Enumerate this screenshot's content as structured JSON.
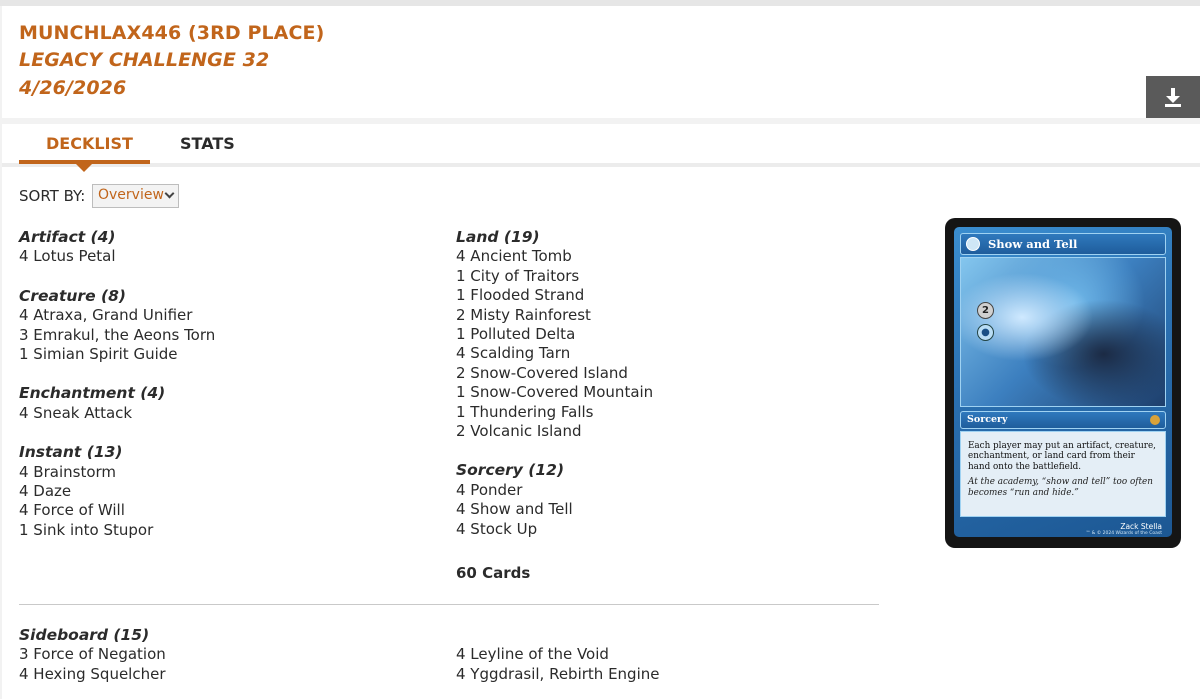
{
  "header": {
    "player": "MUNCHLAX446 (3RD PLACE)",
    "event": "LEGACY CHALLENGE 32",
    "date": "4/26/2026",
    "download_icon": "download-icon"
  },
  "tabs": [
    {
      "label": "DECKLIST",
      "active": true
    },
    {
      "label": "STATS",
      "active": false
    }
  ],
  "sort": {
    "label": "SORT BY:",
    "value": "Overview"
  },
  "main_left": [
    {
      "title": "Artifact (4)",
      "cards": [
        "4 Lotus Petal"
      ]
    },
    {
      "title": "Creature (8)",
      "cards": [
        "4 Atraxa, Grand Unifier",
        "3 Emrakul, the Aeons Torn",
        "1 Simian Spirit Guide"
      ]
    },
    {
      "title": "Enchantment (4)",
      "cards": [
        "4 Sneak Attack"
      ]
    },
    {
      "title": "Instant (13)",
      "cards": [
        "4 Brainstorm",
        "4 Daze",
        "4 Force of Will",
        "1 Sink into Stupor"
      ]
    }
  ],
  "main_right": [
    {
      "title": "Land (19)",
      "cards": [
        "4 Ancient Tomb",
        "1 City of Traitors",
        "1 Flooded Strand",
        "2 Misty Rainforest",
        "1 Polluted Delta",
        "4 Scalding Tarn",
        "2 Snow-Covered Island",
        "1 Snow-Covered Mountain",
        "1 Thundering Falls",
        "2 Volcanic Island"
      ]
    },
    {
      "title": "Sorcery (12)",
      "cards": [
        "4 Ponder",
        "4 Show and Tell",
        "4 Stock Up"
      ]
    }
  ],
  "total": "60 Cards",
  "sideboard": {
    "title": "Sideboard (15)",
    "left": [
      "3 Force of Negation",
      "4 Hexing Squelcher"
    ],
    "right": [
      "4 Leyline of the Void",
      "4 Yggdrasil, Rebirth Engine"
    ]
  },
  "card_preview": {
    "name": "Show and Tell",
    "mana_generic": "2",
    "type": "Sorcery",
    "rules": "Each player may put an artifact, creature, enchantment, or land card from their hand onto the battlefield.",
    "flavor": "At the academy, “show and tell” too often becomes “run and hide.”",
    "artist": "Zack Stella",
    "copyright": "™ & © 2024 Wizards of the Coast"
  }
}
